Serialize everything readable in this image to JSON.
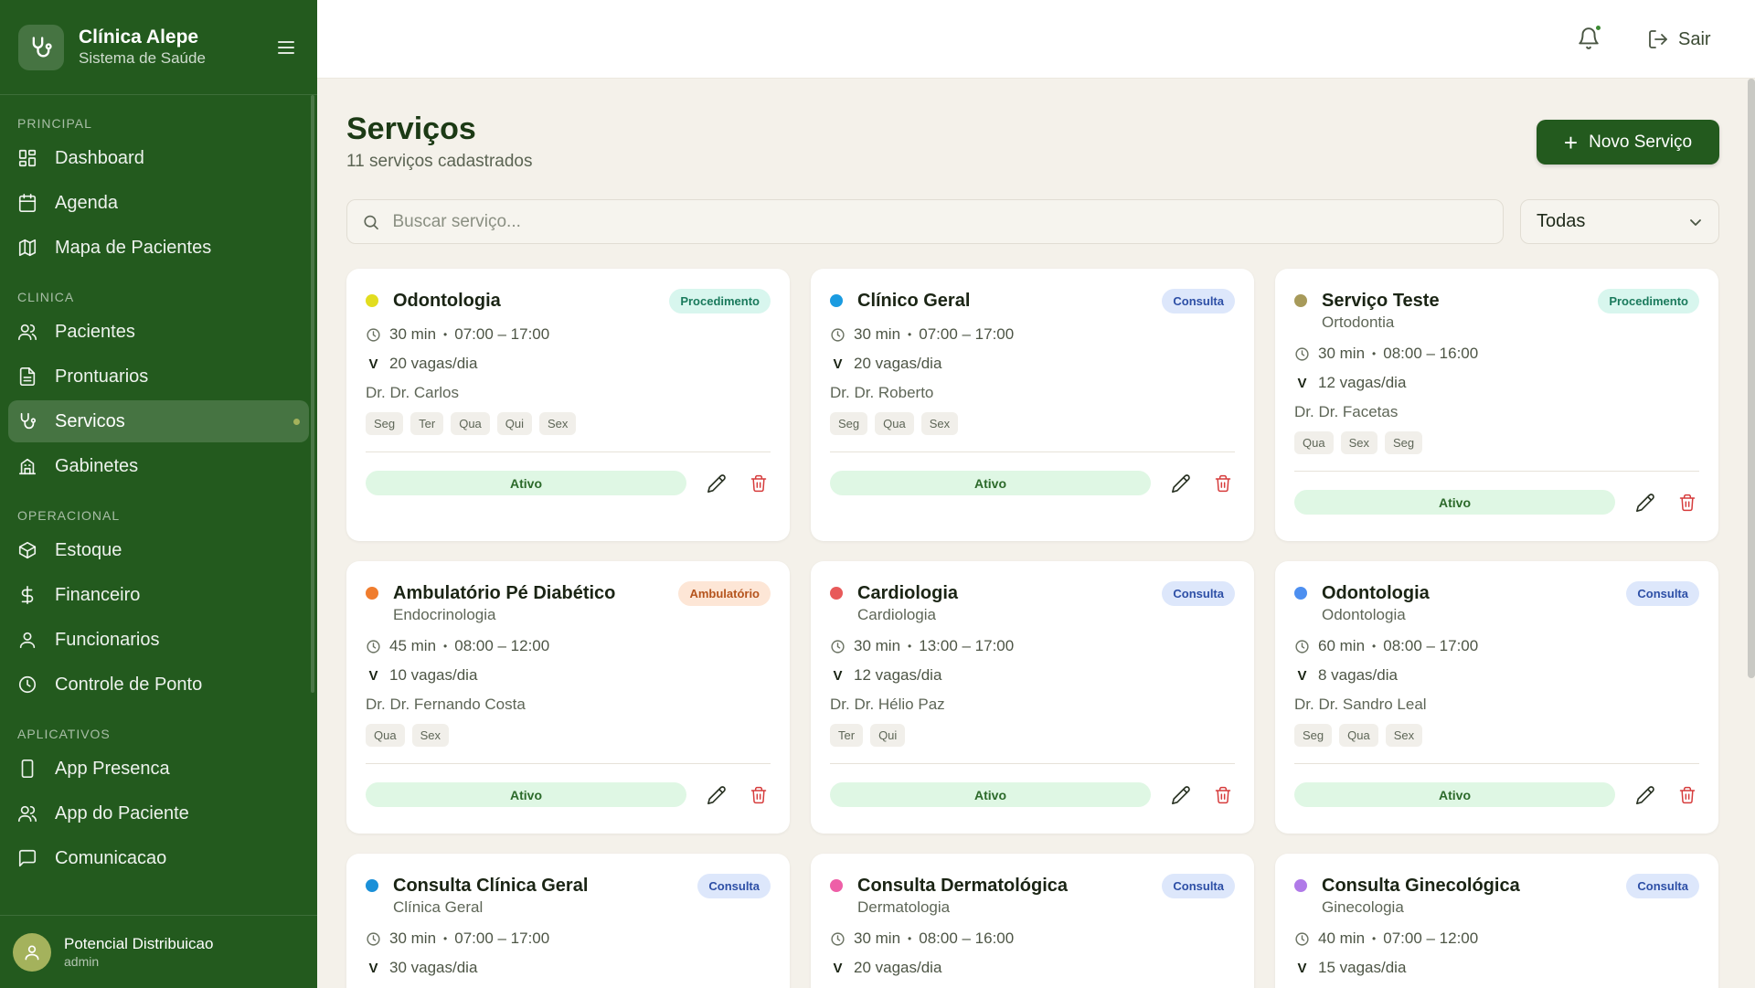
{
  "brand": {
    "title": "Clínica Alepe",
    "subtitle": "Sistema de Saúde"
  },
  "nav": {
    "sections": [
      {
        "label": "PRINCIPAL",
        "items": [
          {
            "label": "Dashboard",
            "icon": "grid-icon"
          },
          {
            "label": "Agenda",
            "icon": "calendar-icon"
          },
          {
            "label": "Mapa de Pacientes",
            "icon": "map-icon"
          }
        ]
      },
      {
        "label": "CLINICA",
        "items": [
          {
            "label": "Pacientes",
            "icon": "users-icon"
          },
          {
            "label": "Prontuarios",
            "icon": "document-icon"
          },
          {
            "label": "Servicos",
            "icon": "stethoscope-icon",
            "active": true
          },
          {
            "label": "Gabinetes",
            "icon": "building-icon"
          }
        ]
      },
      {
        "label": "OPERACIONAL",
        "items": [
          {
            "label": "Estoque",
            "icon": "package-icon"
          },
          {
            "label": "Financeiro",
            "icon": "dollar-icon"
          },
          {
            "label": "Funcionarios",
            "icon": "user-icon"
          },
          {
            "label": "Controle de Ponto",
            "icon": "clock-icon"
          }
        ]
      },
      {
        "label": "APLICATIVOS",
        "items": [
          {
            "label": "App Presenca",
            "icon": "phone-icon"
          },
          {
            "label": "App do Paciente",
            "icon": "users-icon"
          },
          {
            "label": "Comunicacao",
            "icon": "message-icon"
          }
        ]
      }
    ]
  },
  "user": {
    "name": "Potencial Distribuicao",
    "role": "admin"
  },
  "topbar": {
    "logout_label": "Sair"
  },
  "page": {
    "title": "Serviços",
    "subtitle": "11 serviços cadastrados",
    "new_button_label": "Novo Serviço",
    "search_placeholder": "Buscar serviço...",
    "filter_value": "Todas"
  },
  "services": [
    {
      "name": "Odontologia",
      "specialty": "",
      "type": "Procedimento",
      "type_class": "proc",
      "color": "#e2dd1f",
      "duration": "30 min",
      "hours": "07:00 – 17:00",
      "slots": "20 vagas/dia",
      "doctor": "Dr. Dr. Carlos",
      "days": [
        "Seg",
        "Ter",
        "Qua",
        "Qui",
        "Sex"
      ],
      "status": "Ativo"
    },
    {
      "name": "Clínico Geral",
      "specialty": "",
      "type": "Consulta",
      "type_class": "cons",
      "color": "#1a9be0",
      "duration": "30 min",
      "hours": "07:00 – 17:00",
      "slots": "20 vagas/dia",
      "doctor": "Dr. Dr. Roberto",
      "days": [
        "Seg",
        "Qua",
        "Sex"
      ],
      "status": "Ativo"
    },
    {
      "name": "Serviço Teste",
      "specialty": "Ortodontia",
      "type": "Procedimento",
      "type_class": "proc",
      "color": "#a79a5a",
      "duration": "30 min",
      "hours": "08:00 – 16:00",
      "slots": "12 vagas/dia",
      "doctor": "Dr. Dr. Facetas",
      "days": [
        "Qua",
        "Sex",
        "Seg"
      ],
      "status": "Ativo"
    },
    {
      "name": "Ambulatório Pé Diabético",
      "specialty": "Endocrinologia",
      "type": "Ambulatório",
      "type_class": "amb",
      "color": "#f07d2e",
      "duration": "45 min",
      "hours": "08:00 – 12:00",
      "slots": "10 vagas/dia",
      "doctor": "Dr. Dr. Fernando Costa",
      "days": [
        "Qua",
        "Sex"
      ],
      "status": "Ativo"
    },
    {
      "name": "Cardiologia",
      "specialty": "Cardiologia",
      "type": "Consulta",
      "type_class": "cons",
      "color": "#e85a5a",
      "duration": "30 min",
      "hours": "13:00 – 17:00",
      "slots": "12 vagas/dia",
      "doctor": "Dr. Dr. Hélio Paz",
      "days": [
        "Ter",
        "Qui"
      ],
      "status": "Ativo"
    },
    {
      "name": "Odontologia",
      "specialty": "Odontologia",
      "type": "Consulta",
      "type_class": "cons",
      "color": "#4d8ff0",
      "duration": "60 min",
      "hours": "08:00 – 17:00",
      "slots": "8 vagas/dia",
      "doctor": "Dr. Dr. Sandro Leal",
      "days": [
        "Seg",
        "Qua",
        "Sex"
      ],
      "status": "Ativo"
    },
    {
      "name": "Consulta Clínica Geral",
      "specialty": "Clínica Geral",
      "type": "Consulta",
      "type_class": "cons",
      "color": "#1a90d8",
      "duration": "30 min",
      "hours": "07:00 – 17:00",
      "slots": "30 vagas/dia",
      "doctor": "",
      "days": [],
      "status": ""
    },
    {
      "name": "Consulta Dermatológica",
      "specialty": "Dermatologia",
      "type": "Consulta",
      "type_class": "cons",
      "color": "#ee5fa7",
      "duration": "30 min",
      "hours": "08:00 – 16:00",
      "slots": "20 vagas/dia",
      "doctor": "",
      "days": [],
      "status": ""
    },
    {
      "name": "Consulta Ginecológica",
      "specialty": "Ginecologia",
      "type": "Consulta",
      "type_class": "cons",
      "color": "#b07ae8",
      "duration": "40 min",
      "hours": "07:00 – 12:00",
      "slots": "15 vagas/dia",
      "doctor": "",
      "days": [],
      "status": ""
    }
  ]
}
